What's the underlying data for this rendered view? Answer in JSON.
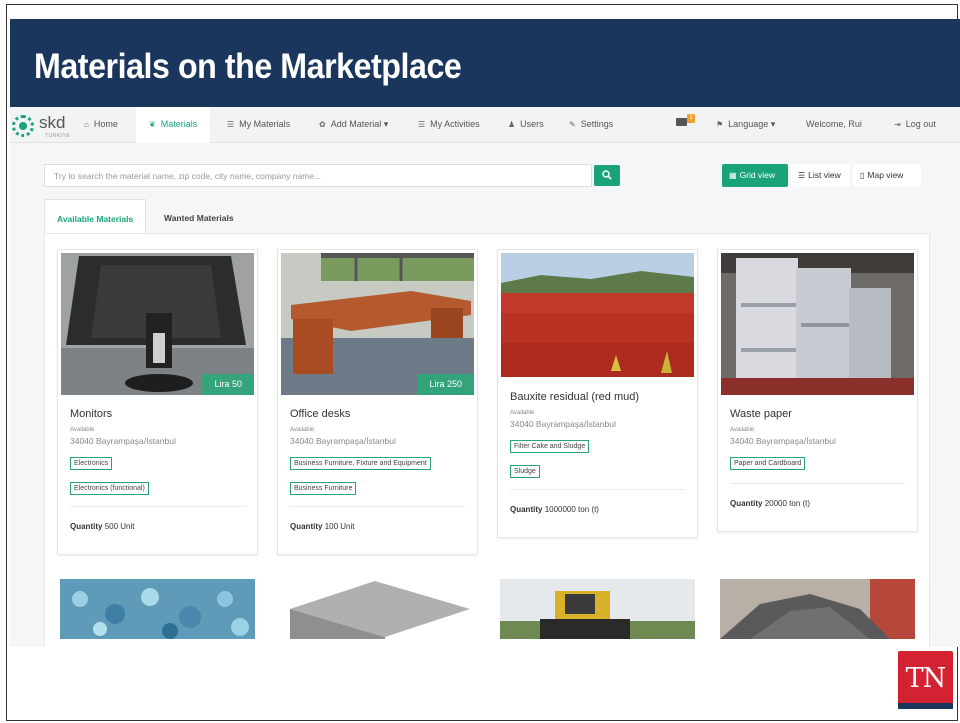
{
  "slide_title": "Materials on the Marketplace",
  "logo": {
    "text": "skd",
    "subtext": "TURKIYE"
  },
  "nav": {
    "items": [
      {
        "label": "Home",
        "icon": "home-icon"
      },
      {
        "label": "Materials",
        "icon": "leaf-icon"
      },
      {
        "label": "My Materials",
        "icon": "list-icon"
      },
      {
        "label": "Add Material ▾",
        "icon": "gear-icon"
      },
      {
        "label": "My Activities",
        "icon": "list-icon"
      },
      {
        "label": "Users",
        "icon": "user-icon"
      },
      {
        "label": "Settings",
        "icon": "wrench-icon"
      }
    ],
    "mail_badge": "1",
    "language": "Language ▾",
    "welcome": "Welcome, Rui",
    "logout": "Log out"
  },
  "search": {
    "placeholder": "Try to search the material name, zip code, city name, company name..."
  },
  "views": {
    "grid": "Grid view",
    "list": "List view",
    "map": "Map view"
  },
  "tabs": {
    "available": "Available Materials",
    "wanted": "Wanted Materials"
  },
  "cards": [
    {
      "name": "Monitors",
      "price": "Lira 50",
      "status": "Available",
      "address": "34040 Bayrampaşa/İstanbul",
      "tags": [
        "Electronics",
        "Electronics (functional)"
      ],
      "qty_label": "Quantity",
      "qty_value": "500 Unit"
    },
    {
      "name": "Office desks",
      "price": "Lira 250",
      "status": "Available",
      "address": "34040 Bayrampaşa/İstanbul",
      "tags": [
        "Business Furniture, Fixture and Equipment",
        "Business Furniture"
      ],
      "qty_label": "Quantity",
      "qty_value": "100 Unit"
    },
    {
      "name": "Bauxite residual (red mud)",
      "status": "Available",
      "address": "34040 Bayrampaşa/İstanbul",
      "tags": [
        "Filter Cake and Sludge",
        "Sludge"
      ],
      "qty_label": "Quantity",
      "qty_value": "1000000 ton (t)"
    },
    {
      "name": "Waste paper",
      "status": "Available",
      "address": "34040 Bayrampaşa/İstanbul",
      "tags": [
        "Paper and Cardboard"
      ],
      "qty_label": "Quantity",
      "qty_value": "20000 ton (t)"
    }
  ],
  "footer_logo": "TN",
  "colors": {
    "banner": "#1b365d",
    "accent": "#1aa37a",
    "tn_red": "#d32333"
  }
}
